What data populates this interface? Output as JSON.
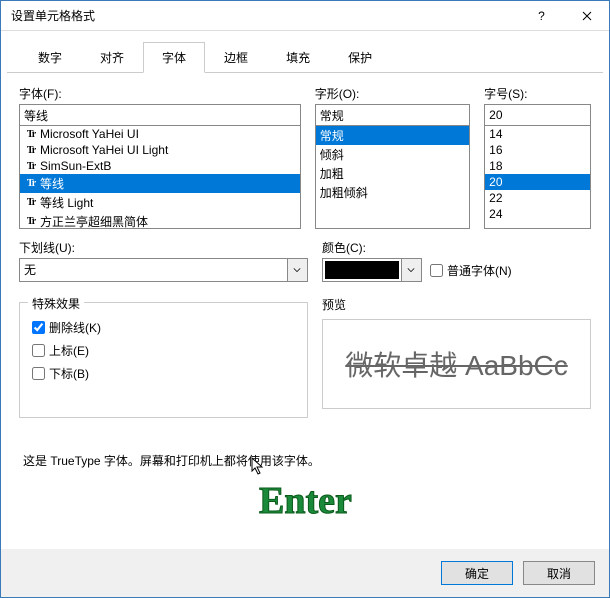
{
  "window": {
    "title": "设置单元格格式",
    "help": "?",
    "close": "×"
  },
  "tabs": [
    "数字",
    "对齐",
    "字体",
    "边框",
    "填充",
    "保护"
  ],
  "active_tab": 2,
  "font": {
    "label": "字体(F):",
    "value": "等线",
    "items": [
      "Microsoft YaHei UI",
      "Microsoft YaHei UI Light",
      "SimSun-ExtB",
      "等线",
      "等线 Light",
      "方正兰亭超细黑简体"
    ],
    "selected_index": 3
  },
  "style": {
    "label": "字形(O):",
    "value": "常规",
    "items": [
      "常规",
      "倾斜",
      "加粗",
      "加粗倾斜"
    ],
    "selected_index": 0
  },
  "size": {
    "label": "字号(S):",
    "value": "20",
    "items": [
      "14",
      "16",
      "18",
      "20",
      "22",
      "24"
    ],
    "selected_index": 3
  },
  "underline": {
    "label": "下划线(U):",
    "value": "无"
  },
  "color": {
    "label": "颜色(C):",
    "value": "#000000"
  },
  "normalfont": {
    "label": "普通字体(N)",
    "checked": false
  },
  "effects": {
    "legend": "特殊效果",
    "strike": {
      "label": "删除线(K)",
      "checked": true
    },
    "super": {
      "label": "上标(E)",
      "checked": false
    },
    "sub": {
      "label": "下标(B)",
      "checked": false
    }
  },
  "preview": {
    "legend": "预览",
    "text": "微软卓越  AaBbCc"
  },
  "info": "这是 TrueType 字体。屏幕和打印机上都将使用该字体。",
  "buttons": {
    "ok": "确定",
    "cancel": "取消"
  },
  "annotation": "Enter"
}
